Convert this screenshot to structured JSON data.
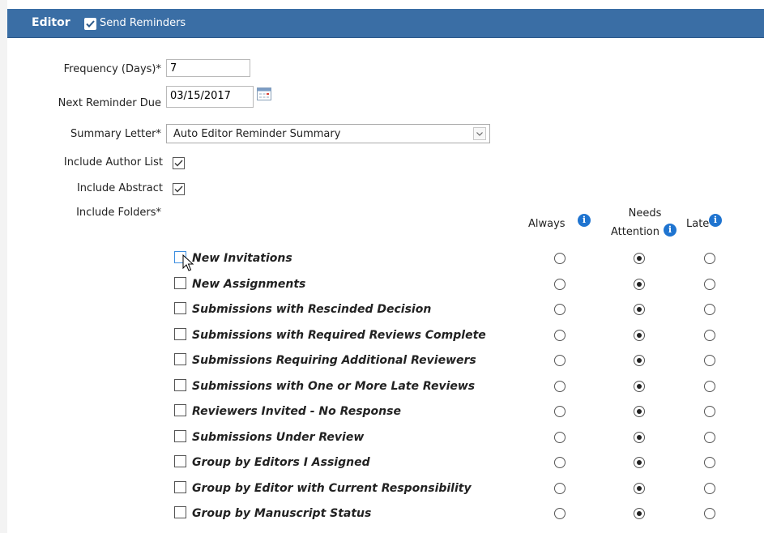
{
  "header": {
    "title": "Editor",
    "send_reminders_label": "Send Reminders",
    "send_reminders_checked": true
  },
  "form": {
    "frequency_label": "Frequency (Days)*",
    "frequency_value": "7",
    "next_due_label": "Next Reminder Due",
    "next_due_value": "03/15/2017",
    "summary_label": "Summary Letter*",
    "summary_value": "Auto Editor Reminder Summary",
    "author_list_label": "Include Author List",
    "author_list_checked": true,
    "abstract_label": "Include Abstract",
    "abstract_checked": true,
    "folders_label": "Include Folders*"
  },
  "columns": {
    "always": "Always",
    "needs_line1": "Needs",
    "needs_line2": "Attention",
    "late": "Late",
    "info_glyph": "i"
  },
  "folders": [
    {
      "label": "New Invitations",
      "checked": false,
      "selected": "needs"
    },
    {
      "label": "New Assignments",
      "checked": false,
      "selected": "needs"
    },
    {
      "label": "Submissions with Rescinded Decision",
      "checked": false,
      "selected": "needs"
    },
    {
      "label": "Submissions with Required Reviews Complete",
      "checked": false,
      "selected": "needs"
    },
    {
      "label": "Submissions Requiring Additional Reviewers",
      "checked": false,
      "selected": "needs"
    },
    {
      "label": "Submissions with One or More Late Reviews",
      "checked": false,
      "selected": "needs"
    },
    {
      "label": "Reviewers Invited - No Response",
      "checked": false,
      "selected": "needs"
    },
    {
      "label": "Submissions Under Review",
      "checked": false,
      "selected": "needs"
    },
    {
      "label": "Group by Editors I Assigned",
      "checked": false,
      "selected": "needs"
    },
    {
      "label": "Group by Editor with Current Responsibility",
      "checked": false,
      "selected": "needs"
    },
    {
      "label": "Group by Manuscript Status",
      "checked": false,
      "selected": "needs"
    }
  ],
  "colors": {
    "header_bg": "#3a6ea5",
    "info_icon": "#1f74d0"
  }
}
